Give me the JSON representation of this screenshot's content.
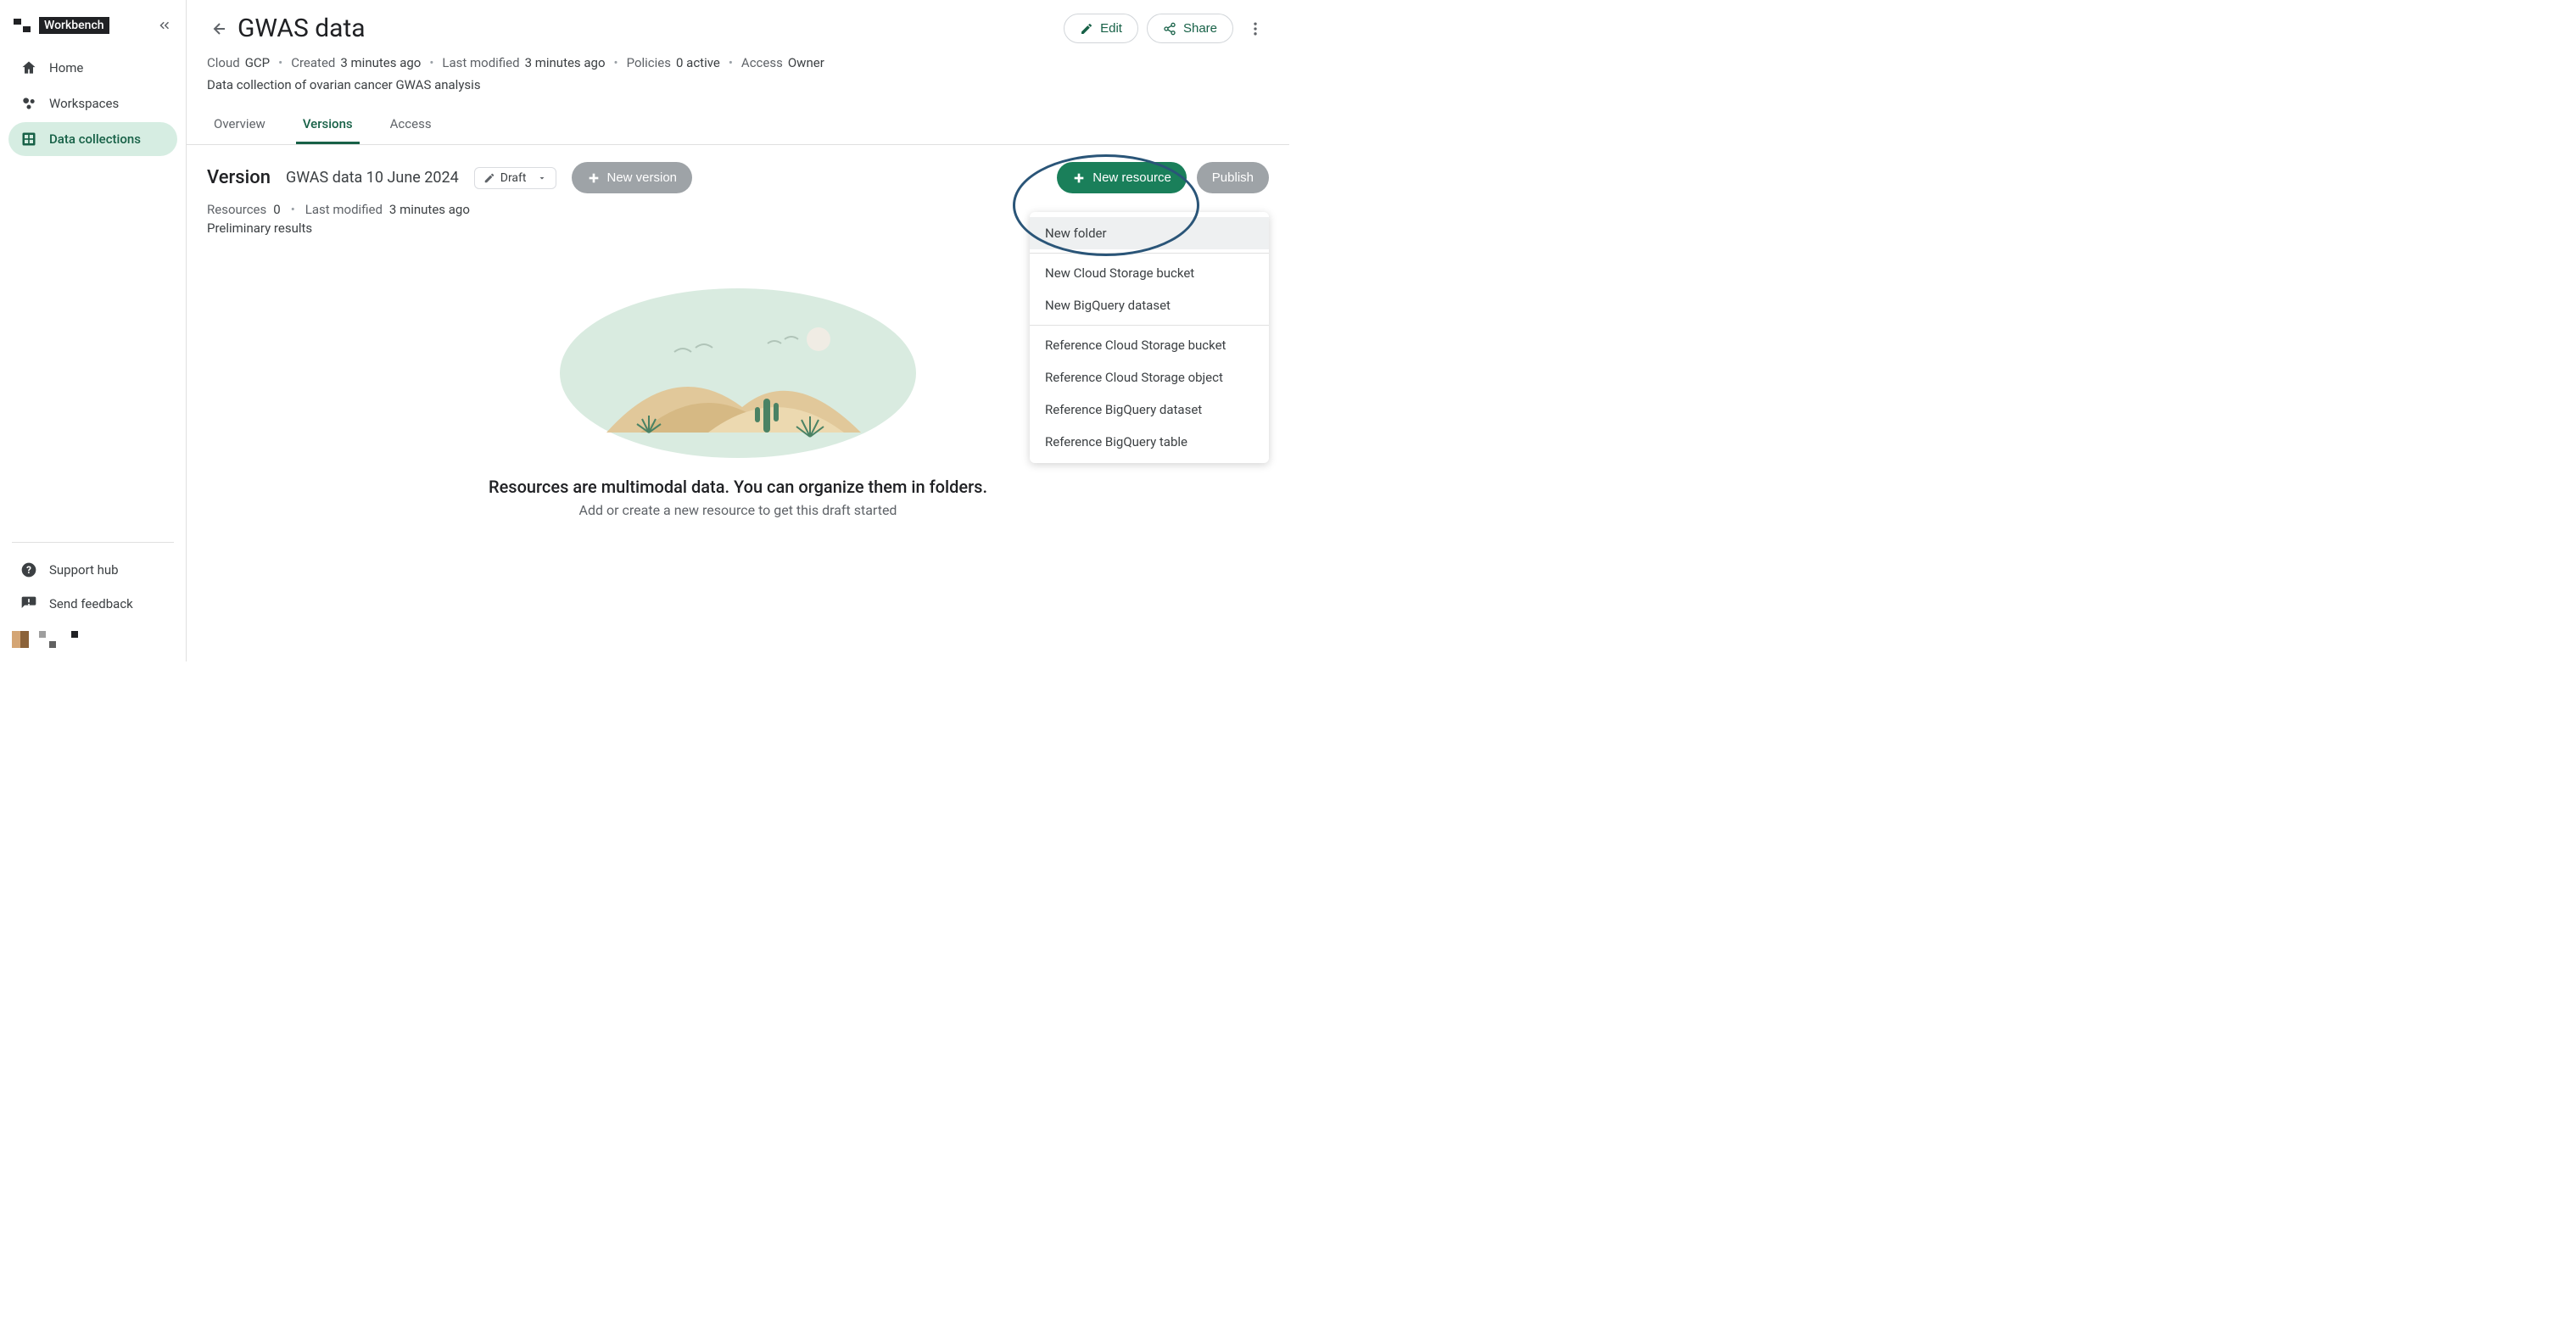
{
  "brand": "Workbench",
  "nav": {
    "home": "Home",
    "workspaces": "Workspaces",
    "dataCollections": "Data collections",
    "supportHub": "Support hub",
    "sendFeedback": "Send feedback"
  },
  "header": {
    "title": "GWAS data",
    "edit": "Edit",
    "share": "Share"
  },
  "meta": {
    "cloudLabel": "Cloud",
    "cloudValue": "GCP",
    "createdLabel": "Created",
    "createdValue": "3 minutes ago",
    "modifiedLabel": "Last modified",
    "modifiedValue": "3 minutes ago",
    "policiesLabel": "Policies",
    "policiesValue": "0 active",
    "accessLabel": "Access",
    "accessValue": "Owner"
  },
  "description": "Data collection of ovarian cancer GWAS analysis",
  "tabs": {
    "overview": "Overview",
    "versions": "Versions",
    "access": "Access"
  },
  "version": {
    "label": "Version",
    "name": "GWAS data 10 June 2024",
    "status": "Draft",
    "newVersion": "New version",
    "newResource": "New resource",
    "publish": "Publish",
    "resourcesLabel": "Resources",
    "resourcesCount": "0",
    "modifiedLabel": "Last modified",
    "modifiedValue": "3 minutes ago",
    "description": "Preliminary results"
  },
  "empty": {
    "title": "Resources are multimodal data. You can organize them in folders.",
    "subtitle": "Add or create a new resource to get this draft started"
  },
  "dropdown": {
    "newFolder": "New folder",
    "newBucket": "New Cloud Storage bucket",
    "newBQDataset": "New BigQuery dataset",
    "refBucket": "Reference Cloud Storage bucket",
    "refObject": "Reference Cloud Storage object",
    "refBQDataset": "Reference BigQuery dataset",
    "refBQTable": "Reference BigQuery table"
  }
}
